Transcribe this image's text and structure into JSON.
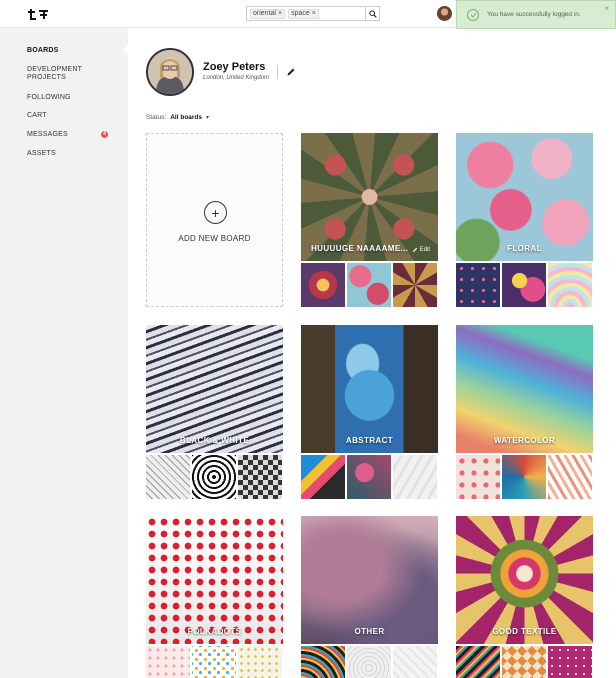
{
  "header": {
    "logo_icon": "lt-logo-icon",
    "search": {
      "tags": [
        "oriental",
        "space"
      ],
      "placeholder": "",
      "value": ""
    }
  },
  "notification": {
    "text": "You have successfully logged in.",
    "type": "success",
    "color": "#d7ecd3"
  },
  "sidebar": {
    "items": [
      {
        "label": "BOARDS",
        "active": true
      },
      {
        "label": "DEVELOPMENT PROJECTS",
        "active": false
      },
      {
        "label": "FOLLOWING",
        "active": false
      },
      {
        "label": "CART",
        "active": false
      },
      {
        "label": "MESSAGES",
        "active": false,
        "badge": "4"
      },
      {
        "label": "ASSETS",
        "active": false
      }
    ]
  },
  "profile": {
    "name": "Zoey Peters",
    "location": "London, United Kingdom"
  },
  "status": {
    "label": "Status:",
    "value": "All boards"
  },
  "add_board": {
    "label": "ADD NEW BOARD"
  },
  "boards": [
    {
      "title": "HUUUUGE NAAAAME...",
      "edit_label": "Edit"
    },
    {
      "title": "FLORAL"
    },
    {
      "title": "BLACK & WHITE"
    },
    {
      "title": "ABSTRACT"
    },
    {
      "title": "WATERCOLOR"
    },
    {
      "title": "POLKADOTS"
    },
    {
      "title": "OTHER"
    },
    {
      "title": "GOOD TEXTILE"
    }
  ],
  "colors": {
    "sidebar_bg": "#f2f2f2",
    "badge": "#e8534f",
    "success": "#d7ecd3"
  }
}
